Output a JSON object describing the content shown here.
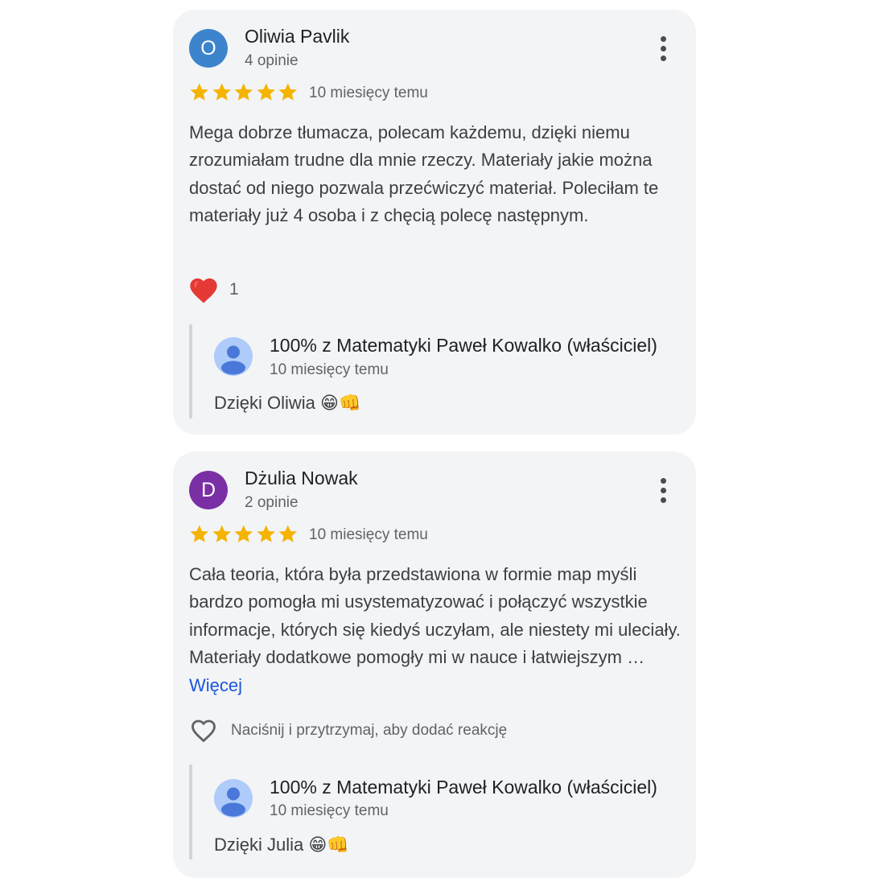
{
  "reviews": [
    {
      "avatar_letter": "O",
      "avatar_color": "#3c84cc",
      "author": "Oliwia Pavlik",
      "review_count": "4 opinie",
      "rating": 5,
      "time": "10 miesięcy temu",
      "text": "Mega dobrze tłumacza, polecam każdemu, dzięki niemu zrozumiałam trudne dla mnie rzeczy. Materiały jakie można dostać od niego pozwala przećwiczyć materiał. Poleciłam te materiały już 4 osoba i z chęcią polecę następnym.",
      "reaction_icon": "heart-filled-icon",
      "reaction_count": "1",
      "owner_reply": {
        "name": "100% z Matematyki Paweł Kowalko (właściciel)",
        "time": "10 miesięcy temu",
        "text": "Dzięki Oliwia 😁👊"
      }
    },
    {
      "avatar_letter": "D",
      "avatar_color": "#7b2fa5",
      "author": "Dżulia Nowak",
      "review_count": "2 opinie",
      "rating": 5,
      "time": "10 miesięcy temu",
      "text": "Cała teoria, która była przedstawiona w formie map myśli bardzo pomogła mi usystematyzować i połączyć wszystkie informacje, których się kiedyś uczyłam, ale niestety mi uleciały. Materiały dodatkowe pomogły mi w nauce i łatwiejszym …",
      "more_label": "Więcej",
      "reaction_icon": "heart-outline-icon",
      "reaction_hint": "Naciśnij i przytrzymaj, aby dodać reakcję",
      "owner_reply": {
        "name": "100% z Matematyki Paweł Kowalko (właściciel)",
        "time": "10 miesięcy temu",
        "text": "Dzięki Julia 😁👊"
      }
    }
  ],
  "colors": {
    "star": "#f4b400",
    "card_background": "#f3f4f6",
    "link": "#1a56db",
    "owner_avatar_bg": "#aecbfa",
    "owner_avatar_fg": "#4a78d9"
  }
}
